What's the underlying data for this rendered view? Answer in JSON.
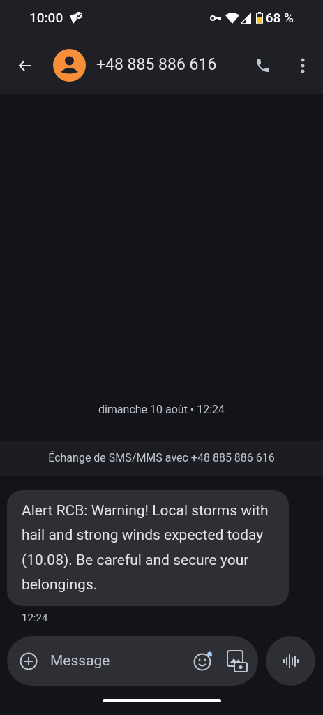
{
  "status_bar": {
    "time": "10:00",
    "battery": "68 %"
  },
  "header": {
    "title": "+48 885 886 616"
  },
  "conversation": {
    "date": "dimanche 10 août • 12:24",
    "banner": "Échange de SMS/MMS avec +48 885 886 616",
    "messages": [
      {
        "text": "Alert RCB: Warning! Local storms with hail and strong winds expected today (10.08). Be careful and secure your belongings.",
        "time": "12:24"
      }
    ]
  },
  "composer": {
    "placeholder": "Message"
  }
}
